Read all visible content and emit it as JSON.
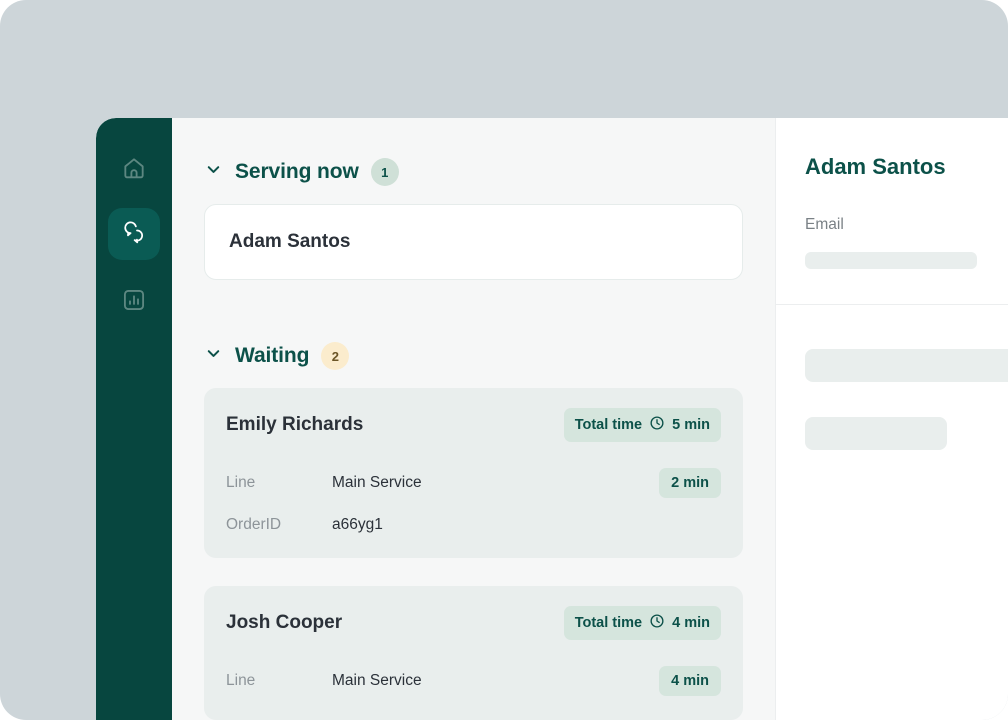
{
  "theme": {
    "page_background": "#cdd5d9",
    "sidebar_background": "#07463f",
    "sidebar_active_background": "#0a5b54",
    "list_background": "#f6f7f7",
    "card_background": "#e9eeed",
    "accent_green": "#0c5149",
    "badge_green": "#d5e5dd",
    "badge_amber": "#fbeccd",
    "panel_background": "#ffffff"
  },
  "sidebar": {
    "items": [
      {
        "name": "home",
        "icon": "home-icon",
        "active": false
      },
      {
        "name": "conversations",
        "icon": "chat-bubbles-icon",
        "active": true
      },
      {
        "name": "analytics",
        "icon": "bar-chart-icon",
        "active": false
      }
    ]
  },
  "main": {
    "sections": [
      {
        "id": "serving-now",
        "title": "Serving now",
        "count": "1",
        "badge_style": "green",
        "expanded": true,
        "entries": [
          {
            "name": "Adam Santos"
          }
        ]
      },
      {
        "id": "waiting",
        "title": "Waiting",
        "count": "2",
        "badge_style": "amber",
        "expanded": true,
        "entries": [
          {
            "name": "Emily Richards",
            "total_time_label": "Total time",
            "total_time_value": "5 min",
            "rows": [
              {
                "key": "Line",
                "value": "Main Service",
                "pill": "2 min"
              },
              {
                "key": "OrderID",
                "value": "a66yg1",
                "pill": ""
              }
            ]
          },
          {
            "name": "Josh Cooper",
            "total_time_label": "Total time",
            "total_time_value": "4 min",
            "rows": [
              {
                "key": "Line",
                "value": "Main Service",
                "pill": "4 min"
              }
            ]
          }
        ]
      }
    ]
  },
  "detail": {
    "title": "Adam Santos",
    "fields": [
      {
        "label": "Email",
        "value": ""
      }
    ]
  }
}
